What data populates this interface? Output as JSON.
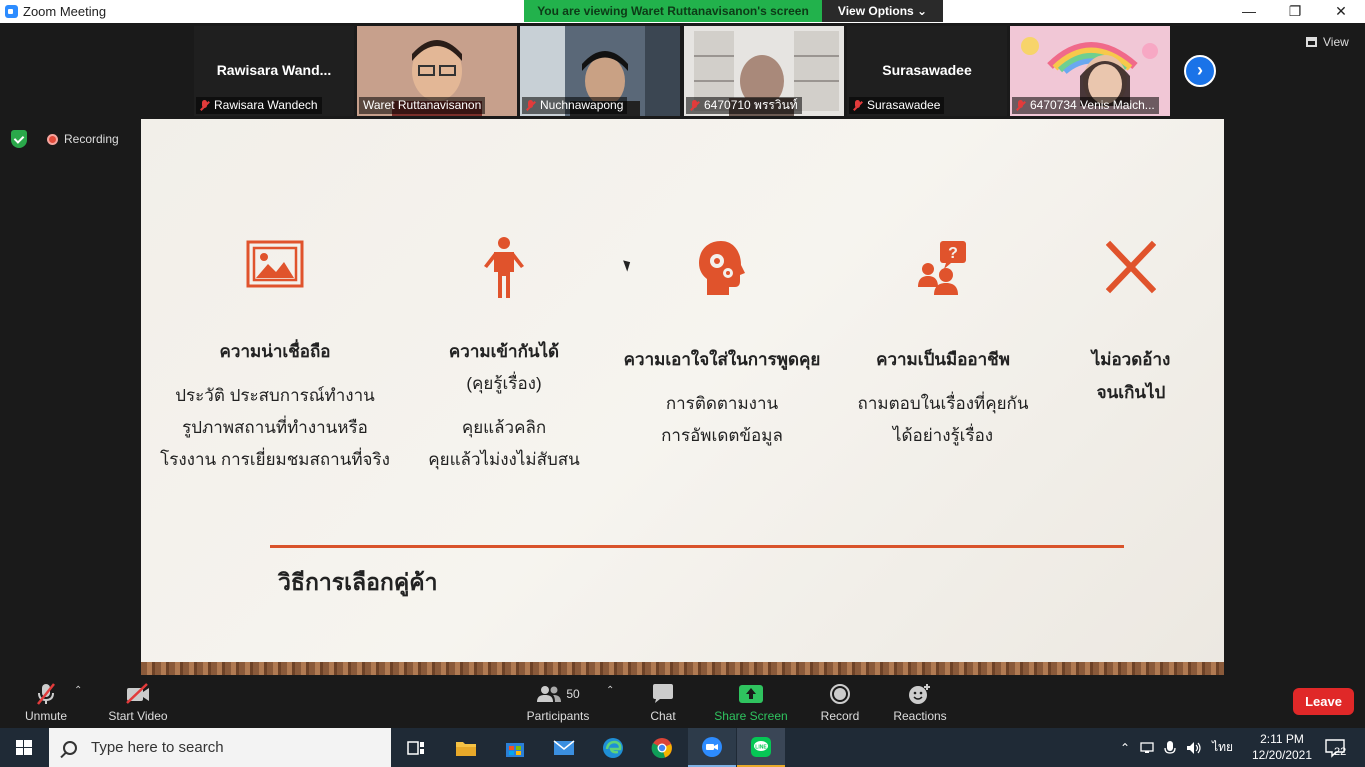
{
  "window": {
    "title": "Zoom Meeting",
    "minimize": "—",
    "restore": "❐",
    "close": "✕"
  },
  "banner": {
    "viewing": "You are viewing Waret Ruttanavisanon's screen",
    "view_options": "View Options ⌄"
  },
  "gallery": {
    "tiles": [
      {
        "big_name": "Rawisara  Wand...",
        "name": "Rawisara Wandech",
        "video": false
      },
      {
        "big_name": "",
        "name": "Waret Ruttanavisanon",
        "video": true,
        "active": true
      },
      {
        "big_name": "",
        "name": "Nuchnawapong",
        "video": true
      },
      {
        "big_name": "",
        "name": "6470710 พรรวินท์",
        "video": true
      },
      {
        "big_name": "Surasawadee",
        "name": "Surasawadee",
        "video": false
      },
      {
        "big_name": "",
        "name": "6470734 Venis Maich...",
        "video": true
      }
    ],
    "next": "›",
    "view_label": "View"
  },
  "status": {
    "recording": "Recording"
  },
  "slide": {
    "columns": [
      {
        "icon": "image-icon",
        "heading": "ความน่าเชื่อถือ",
        "subheading": "",
        "lines": [
          "ประวัติ ประสบการณ์ทำงาน",
          "รูปภาพสถานที่ทำงานหรือ",
          "โรงงาน การเยี่ยมชมสถานที่จริง"
        ]
      },
      {
        "icon": "person-icon",
        "heading": "ความเข้ากันได้",
        "subheading": "(คุยรู้เรื่อง)",
        "lines": [
          "คุยแล้วคลิก",
          "คุยแล้วไม่งงไม่สับสน"
        ]
      },
      {
        "icon": "head-gears-icon",
        "heading": "ความเอาใจใส่ในการพูดคุย",
        "subheading": "",
        "lines": [
          "การติดตามงาน",
          "การอัพเดตข้อมูล"
        ]
      },
      {
        "icon": "people-question-icon",
        "heading": "ความเป็นมืออาชีพ",
        "subheading": "",
        "lines": [
          "ถามตอบในเรื่องที่คุยกัน",
          "ได้อย่างรู้เรื่อง"
        ]
      },
      {
        "icon": "x-mark-icon",
        "heading": "ไม่อวดอ้าง",
        "subheading": "จนเกินไป",
        "lines": []
      }
    ],
    "title": "วิธีการเลือกคู่ค้า",
    "accent": "#e0532c"
  },
  "toolbar": {
    "unmute": "Unmute",
    "start_video": "Start Video",
    "participants": "Participants",
    "participant_count": "50",
    "chat": "Chat",
    "share_screen": "Share Screen",
    "record": "Record",
    "reactions": "Reactions",
    "leave": "Leave"
  },
  "taskbar": {
    "search_placeholder": "Type here to search",
    "lang": "ไทย",
    "time": "2:11 PM",
    "date": "12/20/2021",
    "notifications": "22"
  }
}
